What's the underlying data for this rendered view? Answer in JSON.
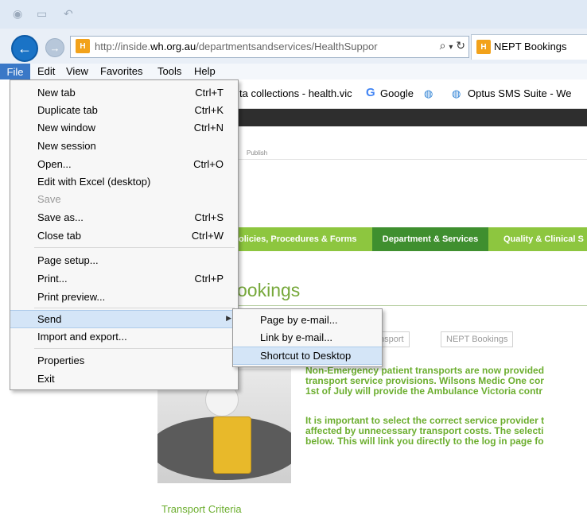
{
  "browser": {
    "url_prefix": "http://inside.",
    "url_domain": "wh.org.au",
    "url_path": "/departmentsandservices/HealthSuppor",
    "tab_title": "NEPT Bookings"
  },
  "menubar": [
    "File",
    "Edit",
    "View",
    "Favorites",
    "Tools",
    "Help"
  ],
  "favorites_bar": {
    "item1": "ta collections - health.vic",
    "item2": "Google",
    "item3": "Optus SMS Suite - We"
  },
  "file_menu": [
    {
      "label": "New tab",
      "shortcut": "Ctrl+T"
    },
    {
      "label": "Duplicate tab",
      "shortcut": "Ctrl+K"
    },
    {
      "label": "New window",
      "shortcut": "Ctrl+N"
    },
    {
      "label": "New session",
      "shortcut": ""
    },
    {
      "label": "Open...",
      "shortcut": "Ctrl+O"
    },
    {
      "label": "Edit with Excel (desktop)",
      "shortcut": ""
    },
    {
      "label": "Save",
      "shortcut": ""
    },
    {
      "label": "Save as...",
      "shortcut": "Ctrl+S"
    },
    {
      "label": "Close tab",
      "shortcut": "Ctrl+W"
    },
    {
      "label": "Page setup...",
      "shortcut": ""
    },
    {
      "label": "Print...",
      "shortcut": "Ctrl+P"
    },
    {
      "label": "Print preview...",
      "shortcut": ""
    },
    {
      "label": "Send",
      "shortcut": ""
    },
    {
      "label": "Import and export...",
      "shortcut": ""
    },
    {
      "label": "Properties",
      "shortcut": ""
    },
    {
      "label": "Exit",
      "shortcut": ""
    }
  ],
  "send_submenu": [
    "Page by e-mail...",
    "Link by e-mail...",
    "Shortcut to Desktop"
  ],
  "page": {
    "publish": "Publish",
    "nav": [
      "olicies, Procedures & Forms",
      "Department & Services",
      "Quality & Clinical S"
    ],
    "title": "ookings",
    "breadcrumb": [
      "nsport",
      "NEPT Bookings"
    ],
    "para1": [
      "Non-Emergency patient transports are now provided",
      "transport service provisions. Wilsons Medic One cor",
      "1st of July will provide the Ambulance Victoria contr"
    ],
    "para2": [
      "It is important to select the correct service provider t",
      "affected by unnecessary transport costs. The selecti",
      "below. This will link you directly to the log in page fo"
    ],
    "caption": "Transport Criteria"
  },
  "colors": {
    "accent": "#3a78c7",
    "green": "#8dc63f",
    "dark_green": "#3f8f2f",
    "text_green": "#6cae2f"
  }
}
